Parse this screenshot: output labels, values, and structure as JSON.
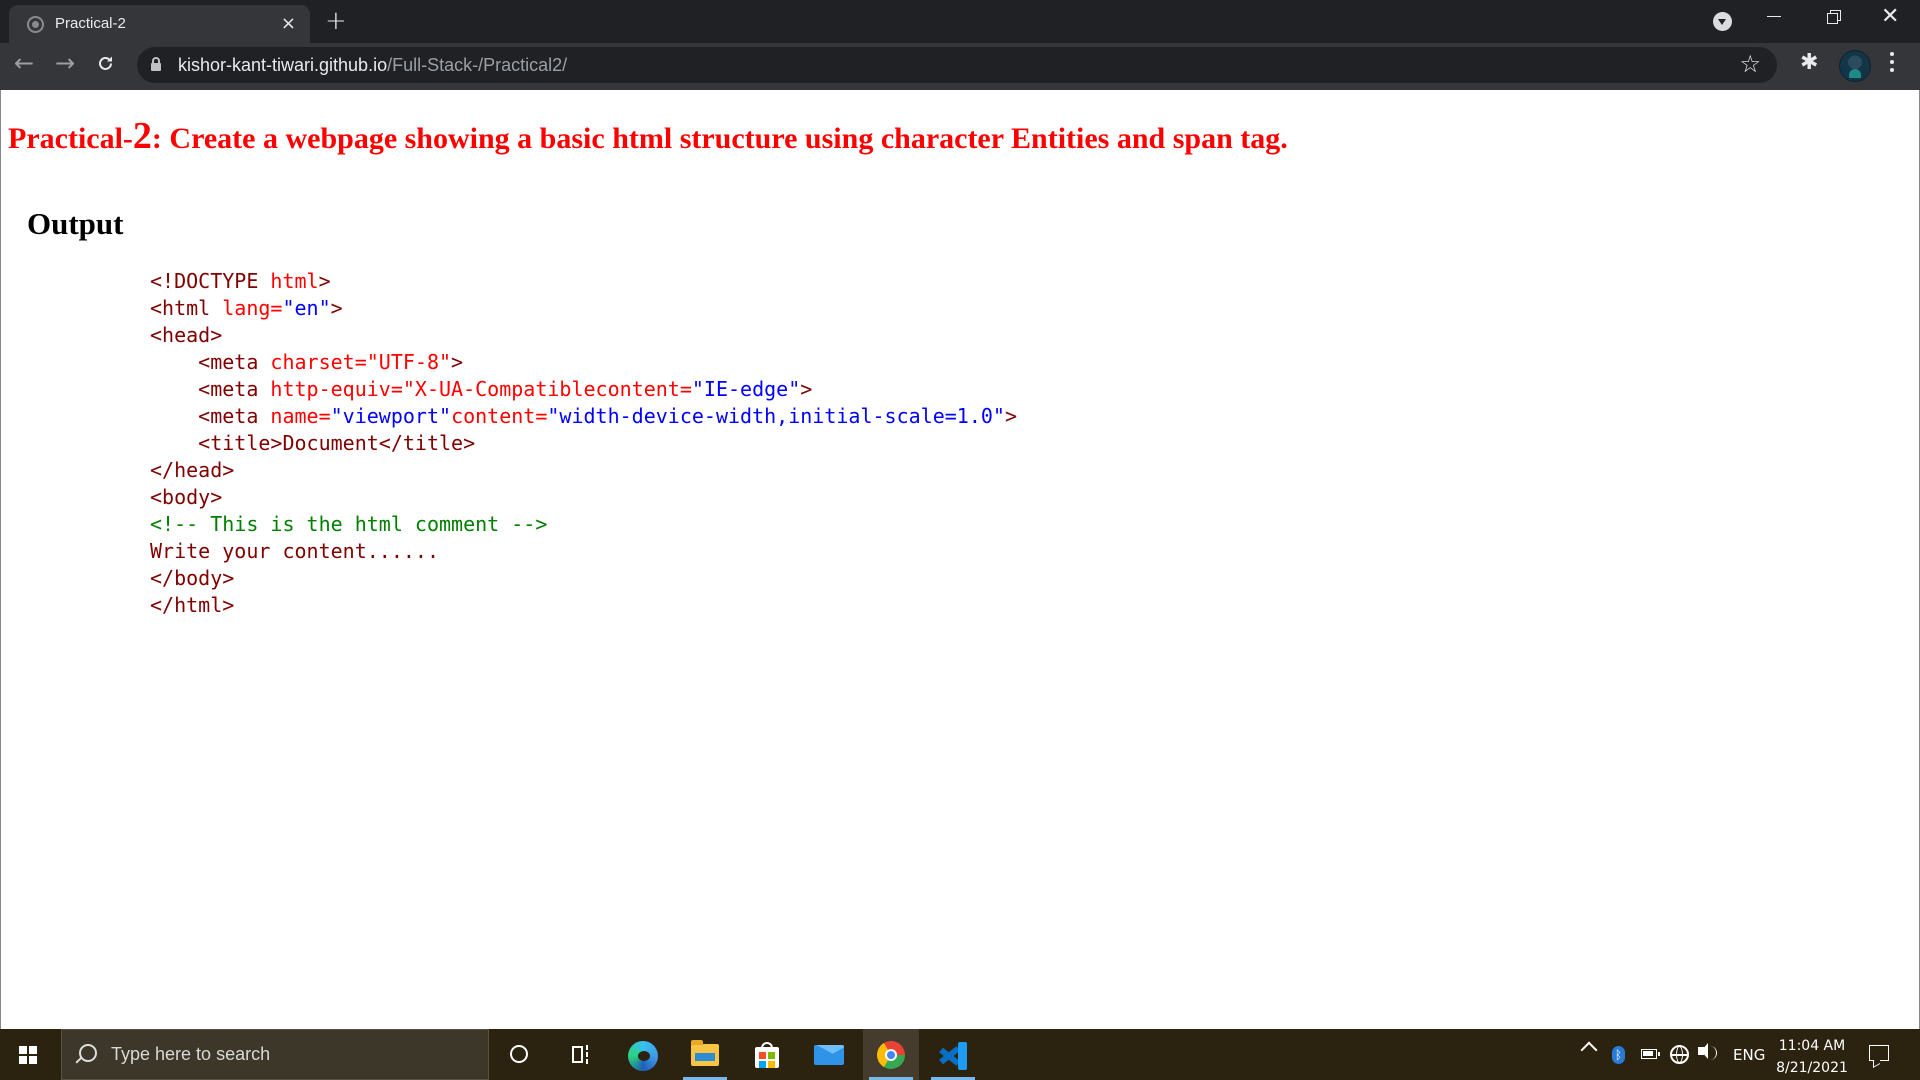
{
  "browser": {
    "tab_title": "Practical-2",
    "tab_close": "×",
    "new_tab": "+",
    "url_host": "kishor-kant-tiwari.github.io",
    "url_path": "/Full-Stack-/Practical2/",
    "back_glyph": "←",
    "forward_glyph": "→",
    "star_glyph": "☆",
    "ext_glyph": "✱",
    "close_glyph": "✕"
  },
  "page": {
    "heading_prefix": "Practical-",
    "heading_number": "2",
    "heading_rest": ": Create a webpage showing a basic html structure using character Entities and span tag.",
    "output_title": "Output",
    "code_lines": [
      [
        {
          "t": "<!DOCTYPE ",
          "c": "tag"
        },
        {
          "t": "html",
          "c": "attr"
        },
        {
          "t": ">",
          "c": "tag"
        }
      ],
      [
        {
          "t": "<html ",
          "c": "tag"
        },
        {
          "t": "lang=",
          "c": "attr"
        },
        {
          "t": "\"en\"",
          "c": "val"
        },
        {
          "t": ">",
          "c": "tag"
        }
      ],
      [
        {
          "t": "<head>",
          "c": "tag"
        }
      ],
      [
        {
          "t": "    <meta ",
          "c": "tag"
        },
        {
          "t": "charset=\"UTF-8\"",
          "c": "attr"
        },
        {
          "t": ">",
          "c": "tag"
        }
      ],
      [
        {
          "t": "    <meta ",
          "c": "tag"
        },
        {
          "t": "http-equiv=\"X-UA-Compatiblecontent=",
          "c": "attr"
        },
        {
          "t": "\"IE-edge\"",
          "c": "val"
        },
        {
          "t": ">",
          "c": "tag"
        }
      ],
      [
        {
          "t": "    <meta ",
          "c": "tag"
        },
        {
          "t": "name=",
          "c": "attr"
        },
        {
          "t": "\"viewport\"",
          "c": "val"
        },
        {
          "t": "content=",
          "c": "attr"
        },
        {
          "t": "\"width-device-width,initial-scale=1.0\"",
          "c": "val"
        },
        {
          "t": ">",
          "c": "tag"
        }
      ],
      [
        {
          "t": "    <title>Document</title>",
          "c": "tag"
        }
      ],
      [
        {
          "t": "</head>",
          "c": "tag"
        }
      ],
      [
        {
          "t": "<body>",
          "c": "tag"
        }
      ],
      [
        {
          "t": "<!-- This is the html comment -->",
          "c": "cmt"
        }
      ],
      [
        {
          "t": "Write your content......",
          "c": "tag"
        }
      ],
      [
        {
          "t": "</body>",
          "c": "tag"
        }
      ],
      [
        {
          "t": "</html>",
          "c": "tag"
        }
      ]
    ]
  },
  "taskbar": {
    "search_placeholder": "Type here to search",
    "language": "ENG",
    "time": "11:04 AM",
    "date": "8/21/2021",
    "bluetooth_glyph": "ᛒ"
  },
  "colors": {
    "heading": "#ff0000",
    "code_tag": "#800000",
    "code_attr": "#ff0000",
    "code_value": "#0000ff",
    "code_comment": "#008000"
  }
}
